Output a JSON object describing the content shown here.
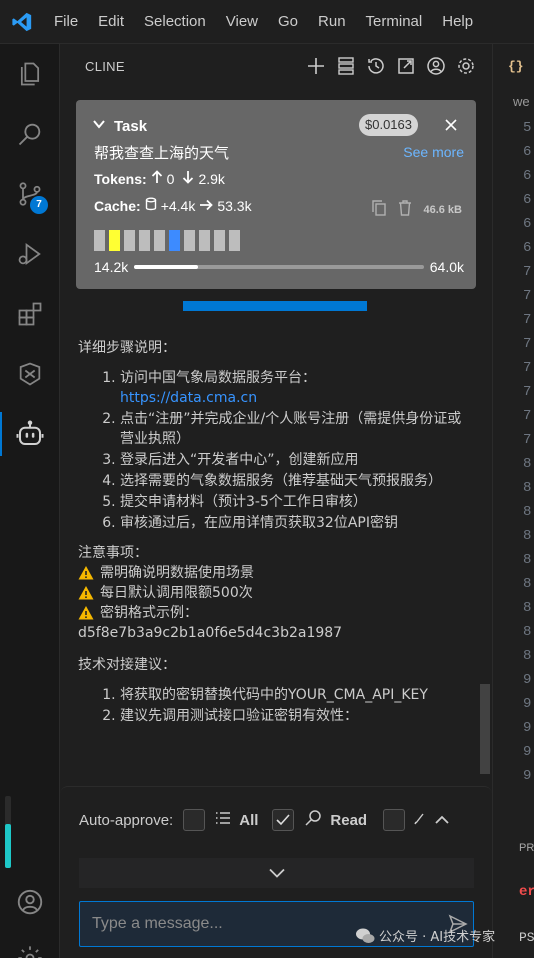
{
  "menubar": {
    "items": [
      "File",
      "Edit",
      "Selection",
      "View",
      "Go",
      "Run",
      "Terminal",
      "Help"
    ]
  },
  "activity": {
    "scm_badge": "7"
  },
  "sidebar": {
    "title": "CLINE"
  },
  "task": {
    "label": "Task",
    "cost": "$0.0163",
    "text": "帮我查查上海的天气",
    "see_more": "See more",
    "tokens_label": "Tokens:",
    "tokens_up": "0",
    "tokens_down": "2.9k",
    "cache_label": "Cache:",
    "cache_write": "+4.4k",
    "cache_read": "53.3k",
    "size": "46.6 kB",
    "context_used": "14.2k",
    "context_max": "64.0k",
    "context_fraction": 0.22
  },
  "content": {
    "steps_heading": "详细步骤说明：",
    "steps": [
      "访问中国气象局数据服务平台：",
      "点击“注册”并完成企业/个人账号注册（需提供身份证或营业执照）",
      "登录后进入“开发者中心”，创建新应用",
      "选择需要的气象数据服务（推荐基础天气预报服务）",
      "提交申请材料（预计3-5个工作日审核）",
      "审核通过后，在应用详情页获取32位API密钥"
    ],
    "link": "https://data.cma.cn",
    "notes_heading": "注意事项：",
    "notes": [
      "需明确说明数据使用场景",
      "每日默认调用限额500次",
      "密钥格式示例："
    ],
    "key_example": "d5f8e7b3a9c2b1a0f6e5d4c3b2a1987",
    "advice_heading": "技术对接建议：",
    "advice": [
      "将获取的密钥替换代码中的YOUR_CMA_API_KEY",
      "建议先调用测试接口验证密钥有效性："
    ]
  },
  "bottom": {
    "auto_approve": "Auto-approve:",
    "all": "All",
    "read": "Read",
    "placeholder": "Type a message..."
  },
  "editor": {
    "tab": "{}",
    "crumb": "we",
    "lines": [
      "5",
      "6",
      "6",
      "6",
      "6",
      "6",
      "7",
      "7",
      "7",
      "7",
      "7",
      "7",
      "7",
      "7",
      "8",
      "8",
      "8",
      "8",
      "8",
      "8",
      "8",
      "8",
      "8",
      "9",
      "9",
      "9",
      "9",
      "9"
    ],
    "panel_title": "PR",
    "panel_err": "er",
    "panel_ps": "PS"
  },
  "watermark": {
    "text": "公众号 · AI技术专家"
  }
}
